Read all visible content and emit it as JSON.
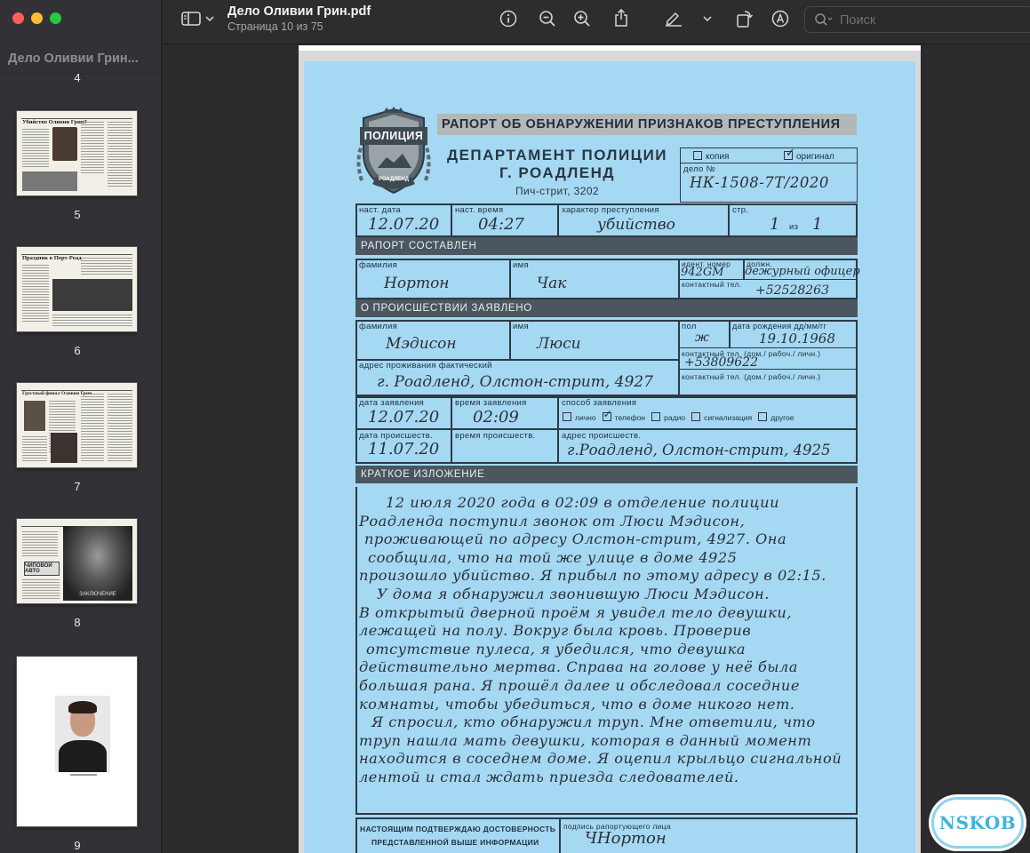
{
  "window": {
    "title": "Дело Оливии Грин.pdf",
    "subtitle": "Страница 10 из 75"
  },
  "sidebar": {
    "title": "Дело Оливии Грин...",
    "page_labels": [
      "4",
      "5",
      "6",
      "7",
      "8",
      "9"
    ],
    "thumb_titles": [
      "Убийство Оливии Грин?",
      "Праздник в Порт-Роад",
      "Грустный финал Оливии Грин"
    ],
    "thumb_ad": "ЧИПОВОЙ АВТО",
    "thumb_caption": "ЗАКЛЮЧЕНИЕ"
  },
  "toolbar": {
    "search_placeholder": "Поиск",
    "icons": [
      "sidebar-toggle-icon",
      "chevron-down-icon",
      "info-icon",
      "zoom-out-icon",
      "zoom-in-icon",
      "share-icon",
      "markup-pen-icon",
      "chevron-down-icon",
      "rotate-icon",
      "annotate-icon",
      "search-icon"
    ]
  },
  "form": {
    "header": "РАПОРТ ОБ ОБНАРУЖЕНИИ ПРИЗНАКОВ ПРЕСТУПЛЕНИЯ",
    "badge_top": "ПОЛИЦИЯ",
    "badge_bottom": "РОАДЛЕНД",
    "dept_line1": "ДЕПАРТАМЕНТ ПОЛИЦИИ",
    "dept_line2": "Г. РОАДЛЕНД",
    "address": "Пич-стрит, 3202",
    "copy_label": "копия",
    "original_label": "оригинал",
    "case_label": "дело №",
    "case_number": "НК-1508-7Т/2020",
    "row1": {
      "date_label": "наст. дата",
      "date": "12.07.20",
      "time_label": "наст. время",
      "time": "04:27",
      "crime_label": "характер преступления",
      "crime": "убийство",
      "page_label": "стр.",
      "page": "1",
      "page_of": "из",
      "page_total": "1"
    },
    "reporter_section": "РАПОРТ СОСТАВЛЕН",
    "reporter": {
      "last_label": "фамилия",
      "last": "Нортон",
      "first_label": "имя",
      "first": "Чак",
      "id_label": "идент. номер",
      "id": "942GM",
      "pos_label": "должн.",
      "pos": "дежурный офицер",
      "contact_label": "контактный тел.",
      "contact": "+52528263"
    },
    "incident_section": "О ПРОИСШЕСТВИИ ЗАЯВЛЕНО",
    "reported_by": {
      "last_label": "фамилия",
      "last": "Мэдисон",
      "first_label": "имя",
      "first": "Люси",
      "sex_label": "пол",
      "sex": "ж",
      "dob_label": "дата рождения дд/мм/гг",
      "dob": "19.10.1968",
      "phone1_label": "контактный тел. (дом./ рабоч./ личн.)",
      "phone1": "+53809622",
      "address_label": "адрес проживания фактический",
      "address": "г. Роадленд, Олстон-стрит, 4927",
      "phone2_label": "контактный тел. (дом./ рабоч./ личн.)"
    },
    "report_details": {
      "report_date_label": "дата заявления",
      "report_date": "12.07.20",
      "report_time_label": "время заявления",
      "report_time": "02:09",
      "method_label": "способ заявления",
      "methods": [
        "лично",
        "телефон",
        "радио",
        "сигнализация",
        "другое"
      ],
      "incident_date_label": "дата происшеств.",
      "incident_date": "11.07.20",
      "incident_time_label": "время происшеств.",
      "incident_address_label": "адрес происшеств.",
      "incident_address": "г.Роадленд, Олстон-стрит, 4925"
    },
    "summary_section": "КРАТКОЕ ИЗЛОЖЕНИЕ",
    "summary_lines": [
      "12 июля 2020 года в 02:09 в отделение полиции",
      "Роадленда поступил звонок от Люси Мэдисон,",
      "проживающей по адресу Олстон-стрит, 4927. Она",
      "сообщила, что на той же улице в доме 4925",
      "произошло убийство. Я прибыл по этому адресу в 02:15.",
      "У дома я обнаружил звонившую Люси Мэдисон.",
      "В открытый дверной проём я увидел тело девушки,",
      "лежащей на полу. Вокруг была кровь. Проверив",
      "отсутствие пулеса, я убедился, что девушка",
      "действительно мертва. Справа на голове у неё была",
      "большая рана. Я прошёл далее и обследовал соседние",
      "комнаты, чтобы убедиться, что в доме никого нет.",
      "Я спросил, кто обнаружил труп. Мне ответили, что",
      "труп нашла мать девушки, которая в данный момент",
      "находится в соседнем доме. Я оцепил крыльцо сигнальной",
      "лентой и стал ждать приезда следователей."
    ],
    "confirm_line1": "НАСТОЯЩИМ ПОДТВЕРЖДАЮ ДОСТОВЕРНОСТЬ",
    "confirm_line2": "ПРЕДСТАВЛЕННОЙ ВЫШЕ ИНФОРМАЦИИ",
    "signature_label": "подпись рапортующего лица",
    "signature": "ЧНортон"
  },
  "watermark": "NSKOB"
}
